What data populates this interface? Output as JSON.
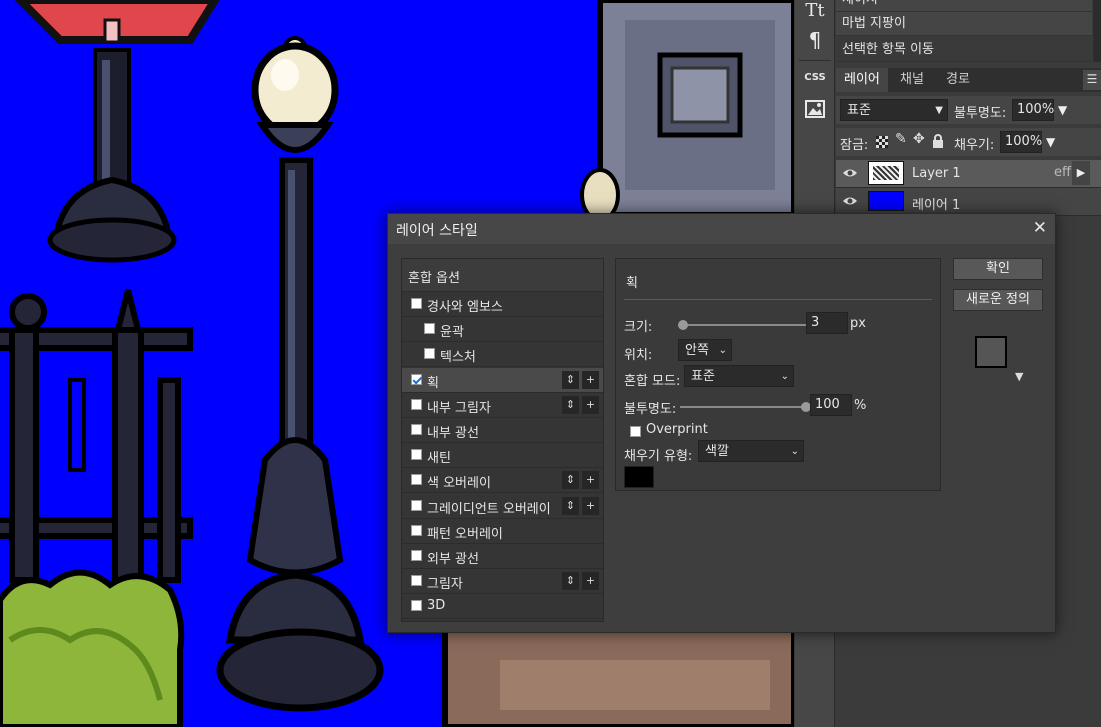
{
  "history": {
    "items": [
      "세이지",
      "마법 지팡이",
      "선택한 항목 이동"
    ]
  },
  "toolbar": {
    "css_label": "CSS"
  },
  "layers_panel": {
    "tabs": [
      "레이어",
      "채널",
      "경로"
    ],
    "menu_icon": "hamburger-icon",
    "blend_mode": "표준",
    "opacity_label": "불투명도:",
    "opacity_value": "100%",
    "lock_label": "잠금:",
    "fill_label": "채우기:",
    "fill_value": "100%",
    "layers": [
      {
        "name": "Layer 1",
        "badge": "eff"
      },
      {
        "name": "레이어 1"
      }
    ]
  },
  "dialog": {
    "title": "레이어 스타일",
    "close_icon": "close-icon",
    "styles_header": "혼합 옵션",
    "styles": [
      {
        "label": "경사와 엠보스",
        "checked": false
      },
      {
        "label": "윤곽",
        "checked": false
      },
      {
        "label": "텍스처",
        "checked": false
      },
      {
        "label": "획",
        "checked": true
      },
      {
        "label": "내부 그림자",
        "checked": false
      },
      {
        "label": "내부 광선",
        "checked": false
      },
      {
        "label": "새틴",
        "checked": false
      },
      {
        "label": "색 오버레이",
        "checked": false
      },
      {
        "label": "그레이디언트 오버레이",
        "checked": false
      },
      {
        "label": "패턴 오버레이",
        "checked": false
      },
      {
        "label": "외부 광선",
        "checked": false
      },
      {
        "label": "그림자",
        "checked": false
      },
      {
        "label": "3D",
        "checked": false
      }
    ],
    "stroke": {
      "title": "획",
      "size_label": "크기:",
      "size_value": "3",
      "size_unit": "px",
      "position_label": "위치:",
      "position_value": "안쪽",
      "blend_label": "혼합 모드:",
      "blend_value": "표준",
      "opacity_label": "불투명도:",
      "opacity_value": "100",
      "opacity_unit": "%",
      "opacity_level": 1.0,
      "overprint_label": "Overprint",
      "overprint_checked": false,
      "fill_type_label": "채우기 유형:",
      "fill_type_value": "색깔",
      "color": "#000000"
    },
    "ok_label": "확인",
    "new_style_label": "새로운 정의"
  }
}
